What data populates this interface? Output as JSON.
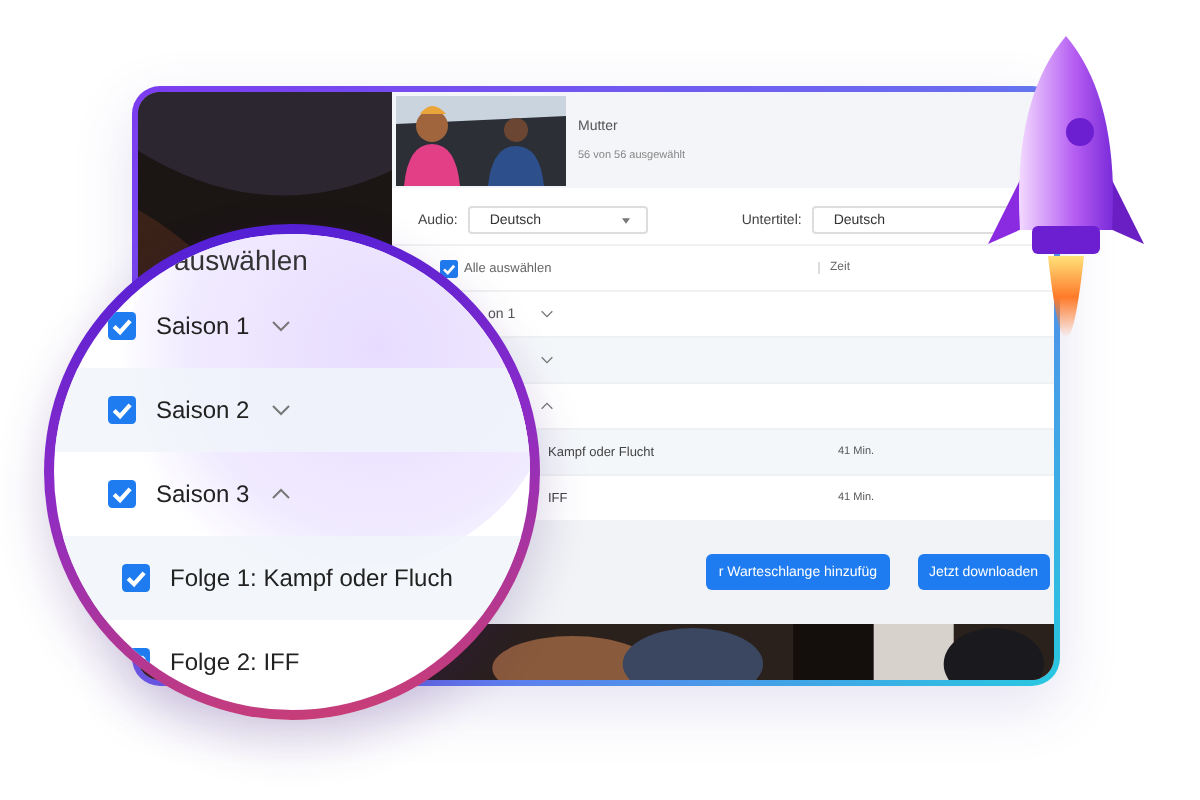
{
  "show": {
    "title": "Mutter",
    "selection": "56 von 56 ausgewählt"
  },
  "audio": {
    "label": "Audio:",
    "value": "Deutsch"
  },
  "subtitles": {
    "label": "Untertitel:",
    "value": "Deutsch"
  },
  "table": {
    "select_all": {
      "label": "Alle auswählen",
      "checked": true
    },
    "time_header": "Zeit",
    "rows": [
      {
        "kind": "season",
        "label": "on 1",
        "expanded": false
      },
      {
        "kind": "season",
        "expanded": false
      },
      {
        "kind": "season",
        "expanded": true
      },
      {
        "kind": "episode",
        "label": "Kampf oder Flucht",
        "time": "41 Min."
      },
      {
        "kind": "episode",
        "label": "IFF",
        "time": "41 Min."
      }
    ]
  },
  "buttons": [
    {
      "label": "r Warteschlange hinzufüg"
    },
    {
      "label": "Jetzt downloaden"
    }
  ],
  "magnifier": {
    "header": "auswählen",
    "rows": [
      {
        "kind": "season",
        "label": "Saison 1",
        "checked": true,
        "expanded": false
      },
      {
        "kind": "season",
        "label": "Saison 2",
        "checked": true,
        "expanded": false
      },
      {
        "kind": "season",
        "label": "Saison 3",
        "checked": true,
        "expanded": true
      },
      {
        "kind": "episode",
        "label": "Folge 1: Kampf oder Fluch",
        "checked": true
      },
      {
        "kind": "episode",
        "label": "Folge 2: IFF",
        "checked": true
      }
    ]
  }
}
